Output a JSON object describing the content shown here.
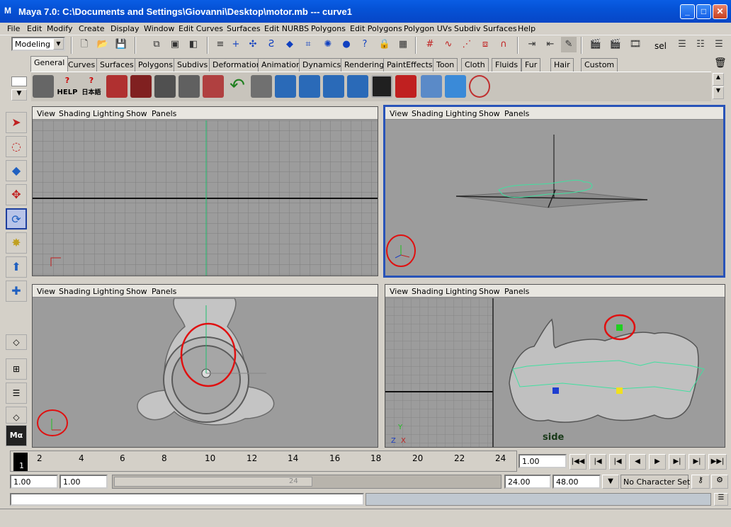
{
  "window": {
    "title": "Maya 7.0: C:\\Documents and Settings\\Giovanni\\Desktop\\motor.mb   ---   curve1",
    "app_icon": "M"
  },
  "menubar": [
    "File",
    "Edit",
    "Modify",
    "Create",
    "Display",
    "Window",
    "Edit Curves",
    "Surfaces",
    "Edit NURBS",
    "Polygons",
    "Edit Polygons",
    "Polygon UVs",
    "Subdiv Surfaces",
    "Help"
  ],
  "mode_selector": {
    "value": "Modeling"
  },
  "status_line": {
    "sel_label": "sel"
  },
  "shelf_tabs": [
    "General",
    "Curves",
    "Surfaces",
    "Polygons",
    "Subdivs",
    "Deformation",
    "Animation",
    "Dynamics",
    "Rendering",
    "PaintEffects",
    "Toon",
    "Cloth",
    "Fluids",
    "Fur",
    "Hair",
    "Custom"
  ],
  "shelf_active_tab": "General",
  "shelf_text": {
    "help": "HELP",
    "japanese": "日本語"
  },
  "viewport_menu": [
    "View",
    "Shading",
    "Lighting",
    "Show",
    "Panels"
  ],
  "viewports": {
    "top_left": {
      "label": ""
    },
    "top_right": {
      "label": ""
    },
    "bottom_left": {
      "label": ""
    },
    "bottom_right": {
      "label": "side"
    }
  },
  "axis_labels": {
    "x": "X",
    "y": "Y",
    "z": "Z"
  },
  "timeline": {
    "ticks": [
      "2",
      "4",
      "6",
      "8",
      "10",
      "12",
      "14",
      "16",
      "18",
      "20",
      "22",
      "24"
    ],
    "current_frame_marker": "1",
    "current_time": "1.00"
  },
  "range": {
    "start": "1.00",
    "playback_start": "1.00",
    "slider_end_label": "24",
    "playback_end": "24.00",
    "end": "48.00",
    "character_set": "No Character Set"
  },
  "colors": {
    "titlebar": "#0552d6",
    "viewport_bg": "#9c9c9c",
    "active_border": "#2853b8",
    "annotation": "#e01010",
    "curve": "#40e0a0"
  }
}
